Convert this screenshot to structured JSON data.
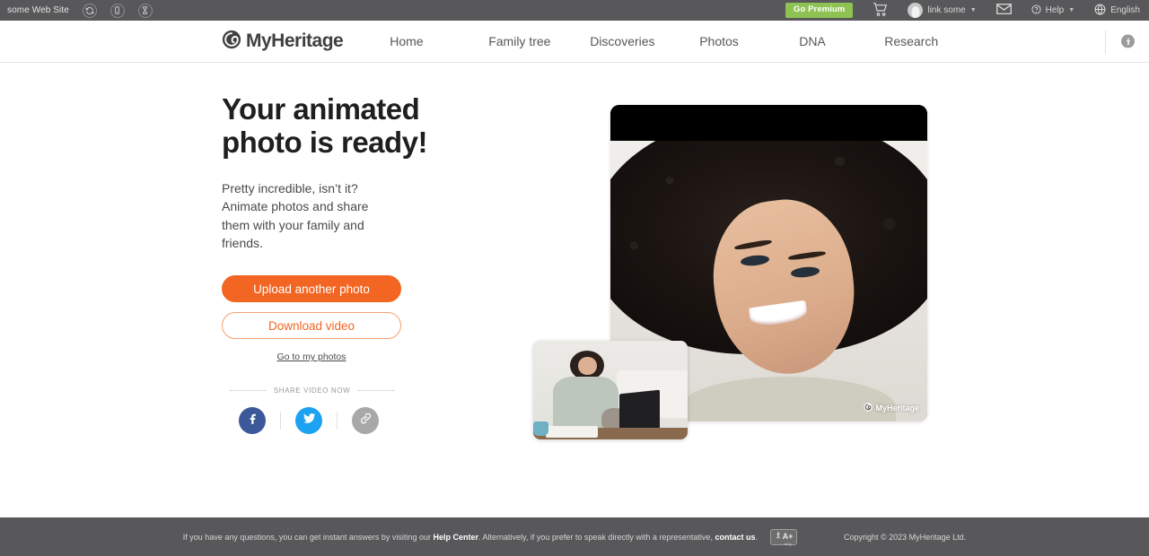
{
  "topbar": {
    "site_label": "some Web Site",
    "icons": [
      {
        "name": "refresh-icon"
      },
      {
        "name": "device-icon"
      },
      {
        "name": "hourglass-icon"
      }
    ],
    "go_premium_label": "Go Premium",
    "cart_icon": "shopping-cart-icon",
    "user_name": "link some",
    "mail_icon": "envelope-icon",
    "help_label": "Help",
    "help_icon": "question-circle-icon",
    "language_label": "English",
    "language_icon": "globe-icon"
  },
  "nav": {
    "brand": "MyHeritage",
    "brand_icon": "myheritage-logo-icon",
    "links": [
      {
        "label": "Home"
      },
      {
        "label": "Family tree"
      },
      {
        "label": "Discoveries"
      },
      {
        "label": "Photos"
      },
      {
        "label": "DNA"
      },
      {
        "label": "Research"
      }
    ],
    "accessibility_icon": "accessibility-icon"
  },
  "main": {
    "headline_line1": "Your animated",
    "headline_line2": "photo is ready!",
    "subcopy": "Pretty incredible, isn’t it? Animate photos and share them with your family and friends.",
    "primary_button": "Upload another photo",
    "secondary_button": "Download video",
    "text_link": "Go to my photos",
    "share_label": "SHARE VIDEO NOW",
    "share_buttons": [
      {
        "name": "facebook-share-button",
        "icon": "facebook-icon",
        "color": "#3b5998"
      },
      {
        "name": "twitter-share-button",
        "icon": "twitter-icon",
        "color": "#1da1f2"
      },
      {
        "name": "copy-link-button",
        "icon": "link-icon",
        "color": "#a8a8a8"
      }
    ],
    "video_watermark": "MyHeritage"
  },
  "footer": {
    "text_before_help": "If you have any questions, you can get instant answers by visiting our ",
    "help_center_link": "Help Center",
    "text_middle": ". Alternatively, if you prefer to speak directly with a representative, ",
    "contact_link": "contact us",
    "text_after": ".",
    "badge_text": "A",
    "badge_plus": "+",
    "badge_sub": "rating",
    "copyright": "Copyright © 2023 MyHeritage Ltd."
  },
  "colors": {
    "brand_orange": "#f26522",
    "premium_green": "#8ec252",
    "bar_gray": "#58585a",
    "facebook_blue": "#3b5998",
    "twitter_blue": "#1da1f2"
  }
}
